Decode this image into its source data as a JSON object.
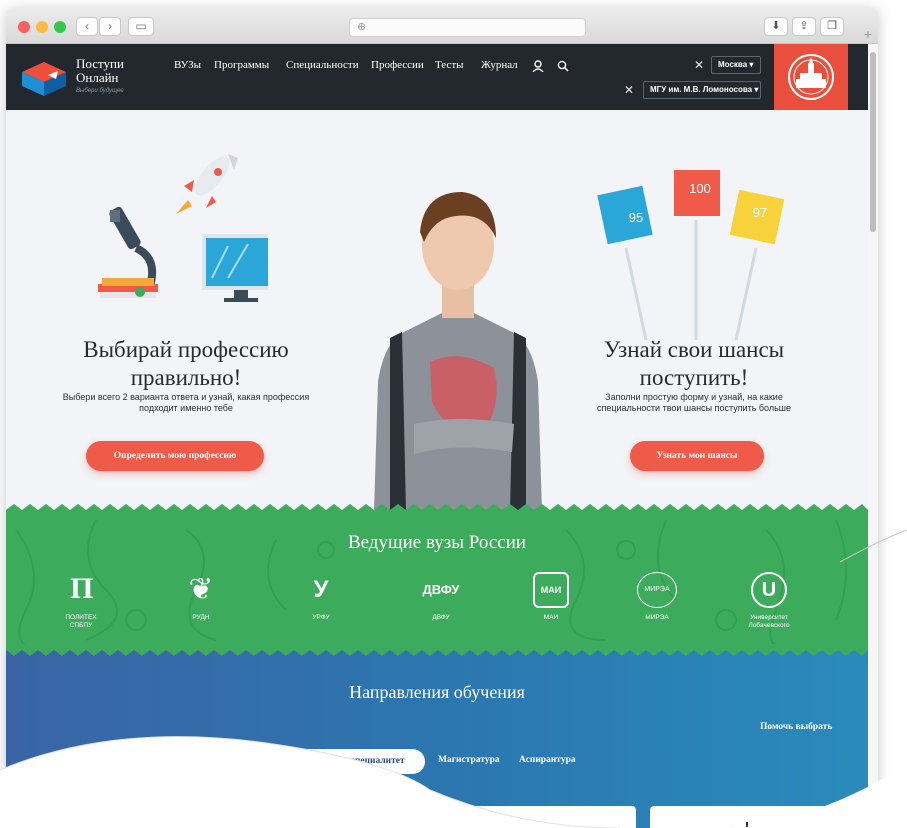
{
  "browser": {
    "address_placeholder": "⊕"
  },
  "site": {
    "brand_line1": "Поступи",
    "brand_line2": "Онлайн",
    "tagline": "Выбери будущее",
    "menu": [
      "ВУЗы",
      "Программы",
      "Специальности",
      "Профессии",
      "Тесты",
      "Журнал"
    ],
    "city_select": "Москва ▾",
    "university_select": "МГУ им. М.В. Ломоносова ▾",
    "clear_mark": "✕"
  },
  "hero": {
    "left_title_line1": "Выбирай профессию",
    "left_title_line2": "правильно!",
    "left_sub_line1": "Выбери всего 2 варианта ответа и узнай, какая профессия",
    "left_sub_line2": "подходит именно тебе",
    "left_button": "Определить мою профессию",
    "right_title_line1": "Узнай свои шансы",
    "right_title_line2": "поступить!",
    "right_sub_line1": "Заполни простую форму и узнай, на какие",
    "right_sub_line2": "специальности твои шансы поступить больше",
    "right_button": "Узнать мои шансы",
    "scores": [
      "95",
      "100",
      "97"
    ]
  },
  "universities": {
    "title": "Ведущие вузы России",
    "items": [
      {
        "mark": "Π",
        "label1": "ПОЛИТЕХ",
        "label2": "СПБПУ"
      },
      {
        "mark": "❦",
        "label1": "РУДН",
        "label2": ""
      },
      {
        "mark": "У",
        "label1": "УРФУ",
        "label2": ""
      },
      {
        "mark": "ДВФУ",
        "label1": "ДВФУ",
        "label2": ""
      },
      {
        "mark": "МАИ",
        "label1": "МАИ",
        "label2": ""
      },
      {
        "mark": "МИРЭА",
        "label1": "МИРЭА",
        "label2": ""
      },
      {
        "mark": "U",
        "label1": "Университет",
        "label2": "Лобачевского"
      }
    ]
  },
  "directions": {
    "title": "Направления обучения",
    "help": "Помочь выбрать",
    "tabs": [
      "Бакалавриат, специалитет",
      "Магистратура",
      "Аспирантура"
    ]
  },
  "colors": {
    "accent": "#ef5a49",
    "green": "#3dab5c",
    "blue": "#2b78b0",
    "nav": "#22282e"
  }
}
